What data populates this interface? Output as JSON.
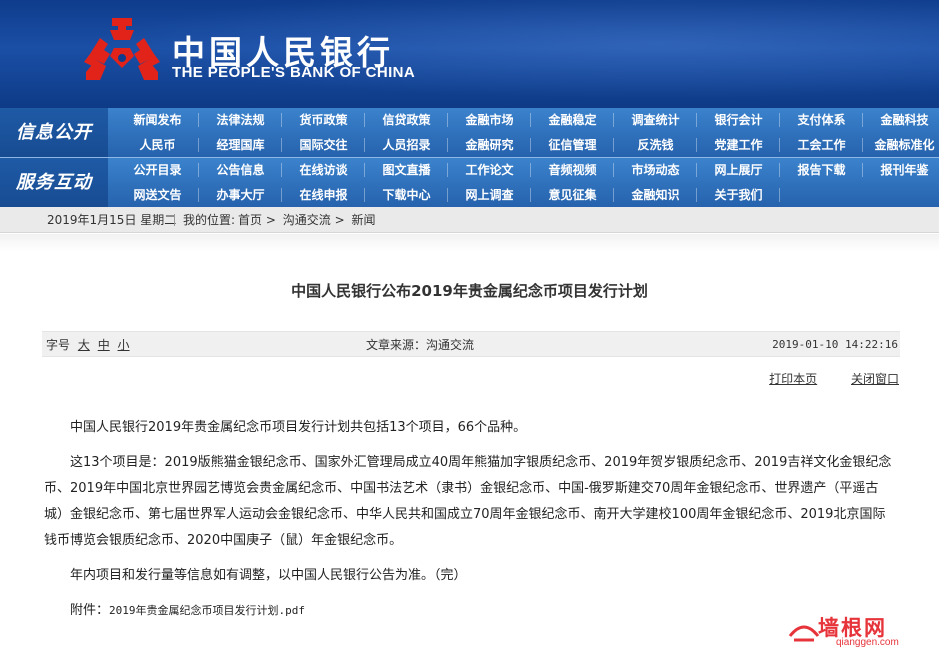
{
  "header": {
    "name_cn": "中国人民银行",
    "name_en": "THE PEOPLE'S BANK OF CHINA",
    "logo_icon": "pboc-emblem-icon",
    "logo_color": "#e2231a"
  },
  "nav": {
    "group1": {
      "label": "信息公开",
      "row1": [
        "新闻发布",
        "法律法规",
        "货币政策",
        "信贷政策",
        "金融市场",
        "金融稳定",
        "调查统计",
        "银行会计",
        "支付体系",
        "金融科技"
      ],
      "row2": [
        "人民币",
        "经理国库",
        "国际交往",
        "人员招录",
        "金融研究",
        "征信管理",
        "反洗钱",
        "党建工作",
        "工会工作",
        "金融标准化"
      ]
    },
    "group2": {
      "label": "服务互动",
      "row1": [
        "公开目录",
        "公告信息",
        "在线访谈",
        "图文直播",
        "工作论文",
        "音频视频",
        "市场动态",
        "网上展厅",
        "报告下载",
        "报刊年鉴"
      ],
      "row2": [
        "网送文告",
        "办事大厅",
        "在线申报",
        "下载中心",
        "网上调查",
        "意见征集",
        "金融知识",
        "关于我们"
      ]
    }
  },
  "breadcrumb": {
    "date": "2019年1月15日 星期二",
    "prefix": "我的位置:",
    "items": [
      "首页",
      "沟通交流",
      "新闻"
    ],
    "separator": ">"
  },
  "article": {
    "title": "中国人民银行公布2019年贵金属纪念币项目发行计划",
    "font_size_label": "字号",
    "font_sizes": [
      "大",
      "中",
      "小"
    ],
    "source": "文章来源：沟通交流",
    "datetime": "2019-01-10 14:22:16",
    "print_label": "打印本页",
    "close_label": "关闭窗口",
    "paragraphs": [
      "中国人民银行2019年贵金属纪念币项目发行计划共包括13个项目，66个品种。",
      "这13个项目是：2019版熊猫金银纪念币、国家外汇管理局成立40周年熊猫加字银质纪念币、2019年贺岁银质纪念币、2019吉祥文化金银纪念币、2019年中国北京世界园艺博览会贵金属纪念币、中国书法艺术（隶书）金银纪念币、中国-俄罗斯建交70周年金银纪念币、世界遗产（平遥古城）金银纪念币、第七届世界军人运动会金银纪念币、中华人民共和国成立70周年金银纪念币、南开大学建校100周年金银纪念币、2019北京国际钱币博览会银质纪念币、2020中国庚子（鼠）年金银纪念币。",
      "年内项目和发行量等信息如有调整，以中国人民银行公告为准。（完）"
    ],
    "attachment_label": "附件：",
    "attachment_file": "2019年贵金属纪念币项目发行计划.pdf"
  },
  "watermark": {
    "text": "墙根网",
    "sub": "qianggen.com",
    "color": "#e6343a"
  }
}
